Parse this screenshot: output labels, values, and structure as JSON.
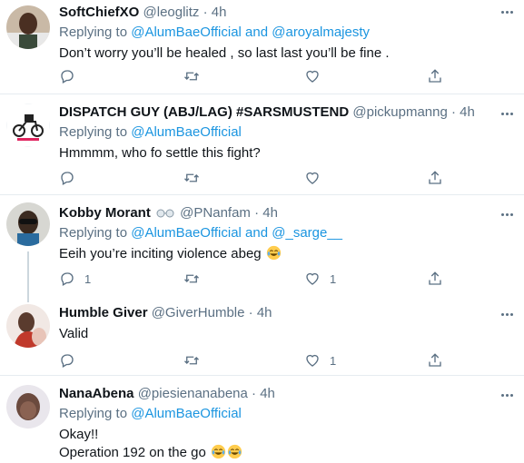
{
  "tweets": [
    {
      "name": "SoftChiefXO",
      "handle": "@leoglitz",
      "time": "4h",
      "replying_prefix": "Replying to",
      "replying_to": "@AlumBaeOfficial and @aroyalmajesty",
      "text": "Don’t worry you’ll be healed , so last last you’ll be fine ."
    },
    {
      "name": "DISPATCH GUY (ABJ/LAG) #SARSMUSTEND",
      "handle": "@pickupmanng",
      "time": "4h",
      "replying_prefix": "Replying to",
      "replying_to": "@AlumBaeOfficial",
      "text": "Hmmmm, who fo settle this fight?"
    },
    {
      "name": "Kobby Morant",
      "handle": "@PNanfam",
      "time": "4h",
      "replying_prefix": "Replying to",
      "replying_to": "@AlumBaeOfficial and @_sarge__",
      "text": "Eeih you’re inciting violence abeg",
      "reply_count": "1",
      "like_count": "1"
    },
    {
      "name": "Humble Giver",
      "handle": "@GiverHumble",
      "time": "4h",
      "text": "Valid",
      "like_count": "1"
    },
    {
      "name": "NanaAbena",
      "handle": "@piesienanabena",
      "time": "4h",
      "replying_prefix": "Replying to",
      "replying_to": "@AlumBaeOfficial",
      "text_line1": "Okay!!",
      "text_line2": "Operation 192 on the go"
    }
  ],
  "separator": "·",
  "icons": {
    "reply": "reply-icon",
    "retweet": "retweet-icon",
    "like": "like-icon",
    "share": "share-icon",
    "more": "more-icon",
    "emoji": "tears-of-joy-emoji",
    "glasses": "glasses-emoji"
  },
  "colors": {
    "link": "#1b95e0",
    "muted": "#5b7083",
    "text": "#0f1419",
    "divider": "#e6ecf0",
    "thread": "#ccd6dd"
  }
}
